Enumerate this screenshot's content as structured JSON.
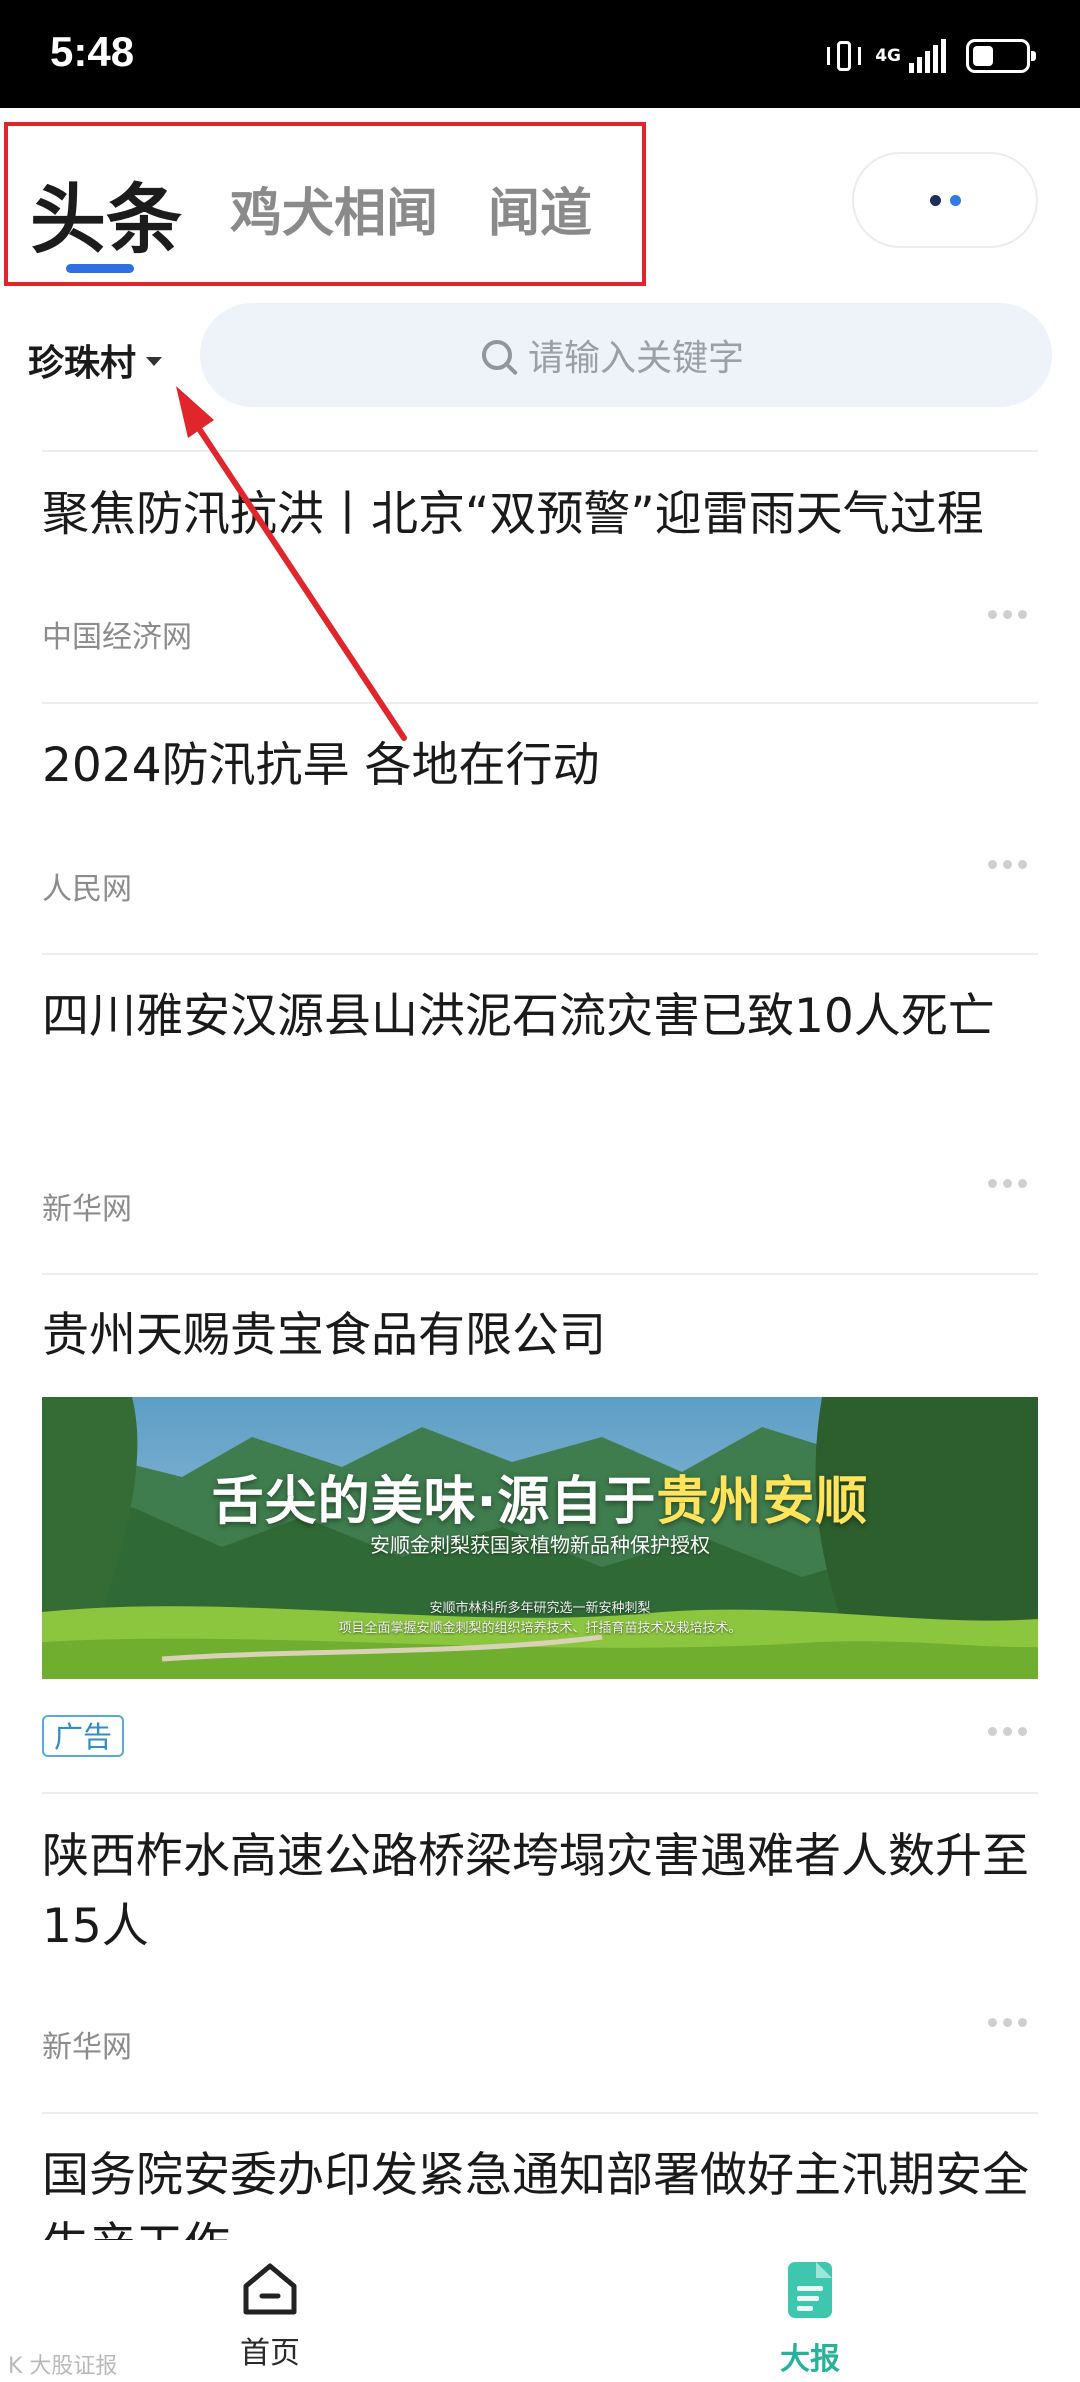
{
  "status_bar": {
    "time": "5:48",
    "network": "4G"
  },
  "tabs": [
    {
      "label": "头条",
      "active": true
    },
    {
      "label": "鸡犬相闻",
      "active": false
    },
    {
      "label": "闻道",
      "active": false
    }
  ],
  "location": {
    "label": "珍珠村"
  },
  "search": {
    "placeholder": "请输入关键字"
  },
  "feed": [
    {
      "title": "聚焦防汛抗洪丨北京“双预警”迎雷雨天气过程",
      "source": "中国经济网"
    },
    {
      "title": "2024防汛抗旱 各地在行动",
      "source": "人民网"
    },
    {
      "title": "四川雅安汉源县山洪泥石流灾害已致10人死亡",
      "source": "新华网"
    },
    {
      "title": "贵州天赐贵宝食品有限公司",
      "ad": {
        "badge": "广告",
        "headline_part1": "舌尖的美味·源自于",
        "headline_part2": "贵州安顺",
        "subline": "安顺金刺梨获国家植物新品种保护授权",
        "small_line1": "安顺市林科所多年研究选一新安种刺梨",
        "small_line2": "项目全面掌握安顺金刺梨的组织培养技术、扦插育苗技术及栽培技术。"
      }
    },
    {
      "title": "陕西柞水高速公路桥梁垮塌灾害遇难者人数升至15人",
      "source": "新华网"
    },
    {
      "title": "国务院安委办印发紧急通知部署做好主汛期安全生产工作"
    }
  ],
  "bottom_nav": [
    {
      "label": "首页",
      "icon": "home-icon",
      "active": false
    },
    {
      "label": "大报",
      "icon": "newspaper-icon",
      "active": true
    }
  ],
  "watermark": "K 大股证报",
  "colors": {
    "accent_blue": "#2f6fe4",
    "active_green": "#27b29b",
    "annotation_red": "#e0262b"
  }
}
